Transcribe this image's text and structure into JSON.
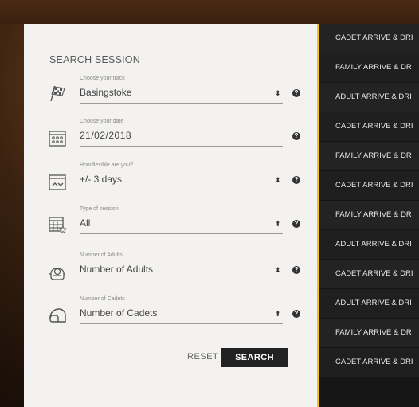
{
  "form": {
    "title": "SEARCH SESSION",
    "track": {
      "caption": "Choose your track",
      "value": "Basingstoke"
    },
    "date": {
      "caption": "Choose your date",
      "value": "21/02/2018"
    },
    "flexible": {
      "caption": "How flexible are you?",
      "value": "+/- 3 days"
    },
    "session_type": {
      "caption": "Type of session",
      "value": "All"
    },
    "adults": {
      "caption": "Number of Adults",
      "value": "Number of Adults"
    },
    "cadets": {
      "caption": "Number of Cadets",
      "value": "Number of Cadets"
    },
    "help_glyph": "?",
    "chevron_glyph": "⬍",
    "reset_label": "RESET",
    "search_label": "SEARCH"
  },
  "sessions": [
    "CADET ARRIVE & DRI",
    "FAMILY ARRIVE & DR",
    "ADULT ARRIVE & DRI",
    "CADET ARRIVE & DRI",
    "FAMILY ARRIVE & DR",
    "CADET ARRIVE & DRI",
    "FAMILY ARRIVE & DR",
    "ADULT ARRIVE & DRI",
    "CADET ARRIVE & DRI",
    "ADULT ARRIVE & DRI",
    "FAMILY ARRIVE & DR",
    "CADET ARRIVE & DRI"
  ],
  "colors": {
    "accent": "#f2c21b",
    "panel": "#f3f2f0",
    "list": "#1f1f1f"
  }
}
